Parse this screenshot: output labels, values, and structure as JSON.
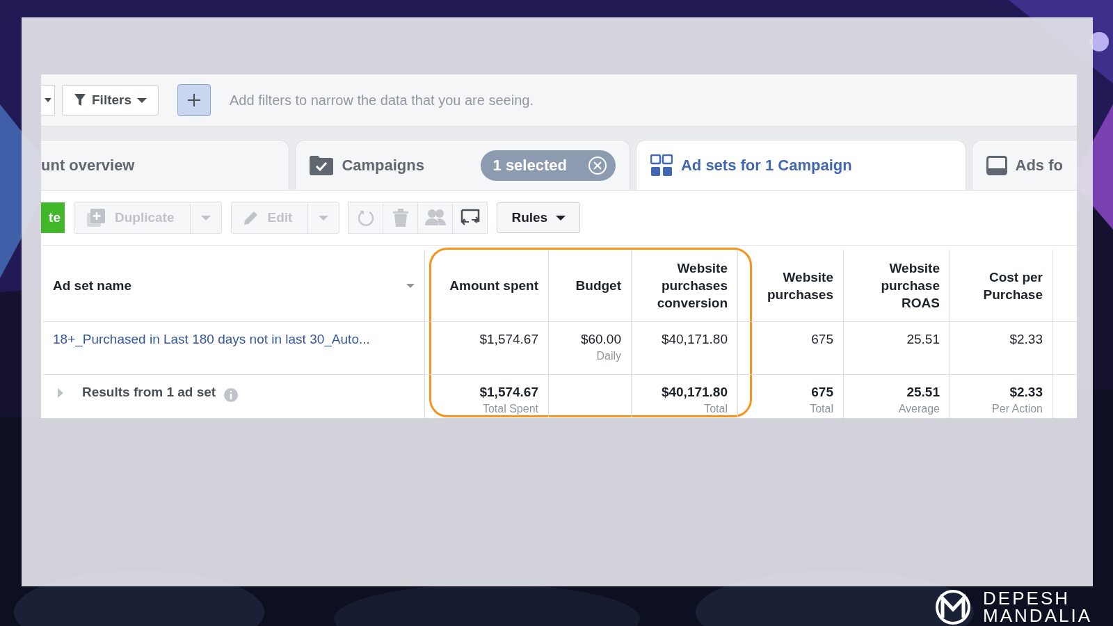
{
  "filter_bar": {
    "filters_button": "Filters",
    "hint": "Add filters to narrow the data that you are seeing."
  },
  "tabs": [
    {
      "kind": "account",
      "label": "unt overview",
      "selected": false
    },
    {
      "kind": "campaigns",
      "label": "Campaigns",
      "badge": "1 selected",
      "selected": false
    },
    {
      "kind": "adsets",
      "label": "Ad sets for 1 Campaign",
      "selected": true
    },
    {
      "kind": "ads",
      "label": "Ads fo",
      "selected": false
    }
  ],
  "toolbar": {
    "create_button": "te",
    "split_buttons": [
      {
        "kind": "duplicate",
        "label": "Duplicate",
        "disabled": true
      },
      {
        "kind": "edit",
        "label": "Edit",
        "disabled": true
      }
    ],
    "icon_buttons": [
      {
        "kind": "refresh",
        "disabled": true
      },
      {
        "kind": "delete",
        "disabled": true
      },
      {
        "kind": "audience",
        "disabled": true
      },
      {
        "kind": "compare",
        "disabled": false
      }
    ],
    "rules_button": "Rules"
  },
  "table": {
    "columns": [
      "Ad set name",
      "Amount spent",
      "Budget",
      "Website purchases conversion",
      "Website purchases",
      "Website purchase ROAS",
      "Cost per Purchase"
    ],
    "rows": [
      {
        "cells": [
          {
            "value": "18+_Purchased in Last 180 days not in last 30_Auto..."
          },
          {
            "value": "$1,574.67"
          },
          {
            "value": "$60.00",
            "sub": "Daily"
          },
          {
            "value": "$40,171.80"
          },
          {
            "value": "675"
          },
          {
            "value": "25.51"
          },
          {
            "value": "$2.33"
          }
        ]
      }
    ],
    "totals": {
      "cells": [
        {
          "value": "Results from 1 ad set"
        },
        {
          "value": "$1,574.67",
          "sub": "Total Spent"
        },
        "",
        {
          "value": "$40,171.80",
          "sub": "Total"
        },
        {
          "value": "675",
          "sub": "Total"
        },
        {
          "value": "25.51",
          "sub": "Average"
        },
        {
          "value": "$2.33",
          "sub": "Per Action"
        }
      ]
    }
  },
  "logo": {
    "line_1": "DEPESH",
    "line_2": "MANDALIA"
  }
}
